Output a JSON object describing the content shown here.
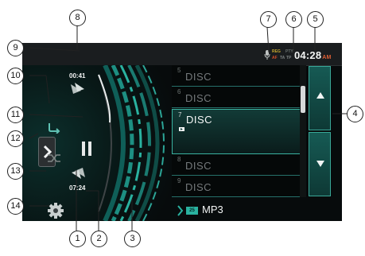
{
  "status_bar": {
    "indicators": {
      "reg": "REG",
      "pty": "PTY",
      "af": "AF",
      "ta": "TA",
      "tp": "TP"
    },
    "time": "04:28",
    "ampm": "AM"
  },
  "player": {
    "elapsed_time": "00:41",
    "total_time": "07:24",
    "accent_color": "#2ab2a0"
  },
  "list": {
    "items": [
      {
        "number": "5",
        "label": "DISC"
      },
      {
        "number": "6",
        "label": "DISC"
      },
      {
        "number": "7",
        "label": "DISC",
        "selected": true
      },
      {
        "number": "8",
        "label": "DISC"
      },
      {
        "number": "9",
        "label": "DISC"
      }
    ]
  },
  "source": {
    "badge": "25",
    "label": "MP3"
  },
  "icons": [
    "mic-icon",
    "repeat-icon",
    "chevron-right-icon",
    "shuffle-icon",
    "pause-icon",
    "next-track-icon",
    "previous-track-icon",
    "gear-icon",
    "arrow-up-icon",
    "arrow-down-icon"
  ],
  "callouts": [
    "1",
    "2",
    "3",
    "4",
    "5",
    "6",
    "7",
    "8",
    "9",
    "10",
    "11",
    "12",
    "13",
    "14"
  ]
}
